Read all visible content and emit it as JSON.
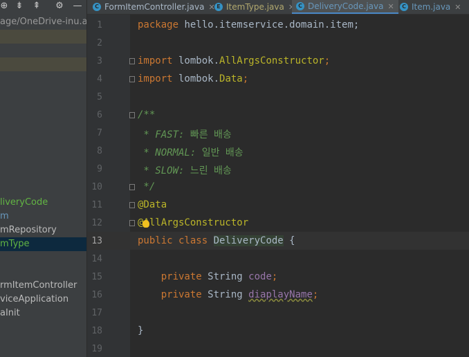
{
  "left_panel": {
    "path": "age/OneDrive-inu.ac.",
    "tree_items": [
      {
        "label": "liveryCode",
        "style": "green"
      },
      {
        "label": "m",
        "style": "blue"
      },
      {
        "label": "mRepository",
        "style": "normal"
      },
      {
        "label": "mType",
        "style": "green"
      },
      {
        "label": "rmItemController",
        "style": "normal"
      },
      {
        "label": "viceApplication",
        "style": "normal"
      },
      {
        "label": "aInit",
        "style": "normal"
      }
    ]
  },
  "tabs": [
    {
      "label": "FormItemController.java",
      "icon": "C",
      "active": false
    },
    {
      "label": "ItemType.java",
      "icon": "E",
      "active": false
    },
    {
      "label": "DeliveryCode.java",
      "icon": "C",
      "active": true
    },
    {
      "label": "Item.java",
      "icon": "C",
      "active": false
    }
  ],
  "editor": {
    "current_line": 13,
    "line_numbers": [
      "1",
      "2",
      "3",
      "4",
      "5",
      "6",
      "7",
      "8",
      "9",
      "10",
      "11",
      "12",
      "13",
      "14",
      "15",
      "16",
      "17",
      "18",
      "19"
    ],
    "code": {
      "l1_kw": "package",
      "l1_rest": " hello.itemservice.domain.item;",
      "l3_kw": "import",
      "l3_pkg": " lombok.",
      "l3_cls": "AllArgsConstructor",
      "l3_semi": ";",
      "l4_kw": "import",
      "l4_pkg": " lombok.",
      "l4_cls": "Data",
      "l4_semi": ";",
      "l6": "/**",
      "l7_tag": " * FAST:",
      "l7_text": " 빠른 배송",
      "l8_tag": " * NORMAL:",
      "l8_text": " 일반 배송",
      "l9_tag": " * SLOW:",
      "l9_text": " 느린 배송",
      "l10": " */",
      "l11": "@Data",
      "l12": "@AllArgsConstructor",
      "l13_kw": "public class",
      "l13_cls": "DeliveryCode",
      "l13_rest": " {",
      "l15_kw": "    private",
      "l15_type": " String ",
      "l15_field": "code",
      "l15_semi": ";",
      "l16_kw": "    private",
      "l16_type": " String ",
      "l16_field": "diaplayName",
      "l16_semi": ";",
      "l18": "}"
    }
  },
  "colors": {
    "keyword": "#cc7832",
    "annotation": "#bbb529",
    "javadoc": "#629755",
    "field": "#9876aa",
    "default_text": "#a9b7c6"
  }
}
